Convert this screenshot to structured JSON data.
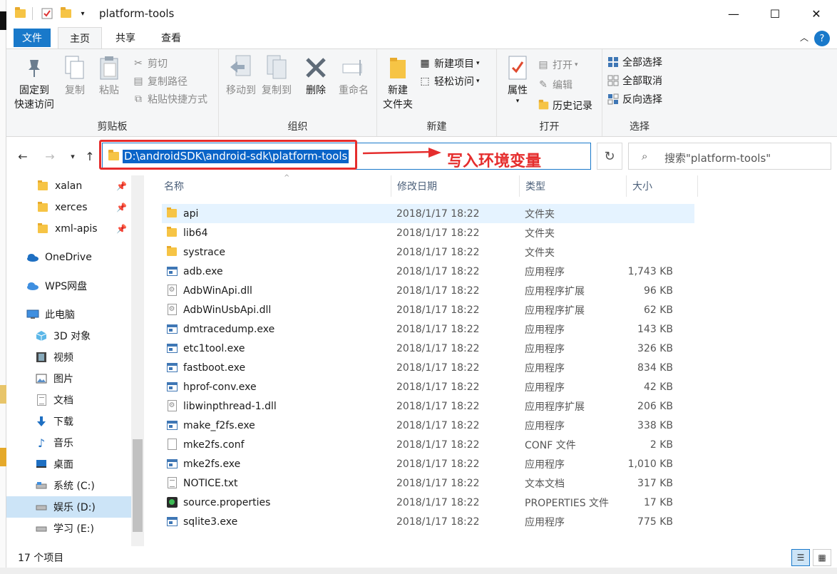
{
  "window": {
    "title": "platform-tools",
    "controls": {
      "minimize": "—",
      "maximize": "☐",
      "close": "✕"
    }
  },
  "tabs": {
    "file": "文件",
    "home": "主页",
    "share": "共享",
    "view": "查看",
    "help": "?"
  },
  "ribbon": {
    "clipboard": {
      "label": "剪贴板",
      "pin": "固定到\n快速访问",
      "pin_l1": "固定到",
      "pin_l2": "快速访问",
      "copy": "复制",
      "paste": "粘贴",
      "cut": "剪切",
      "copy_path": "复制路径",
      "paste_shortcut": "粘贴快捷方式"
    },
    "organize": {
      "label": "组织",
      "move_to": "移动到",
      "copy_to": "复制到",
      "delete": "删除",
      "rename": "重命名"
    },
    "new": {
      "label": "新建",
      "new_folder_l1": "新建",
      "new_folder_l2": "文件夹",
      "new_item": "新建项目",
      "easy_access": "轻松访问"
    },
    "open": {
      "label": "打开",
      "properties": "属性",
      "open": "打开",
      "edit": "编辑",
      "history": "历史记录"
    },
    "select": {
      "label": "选择",
      "select_all": "全部选择",
      "select_none": "全部取消",
      "invert": "反向选择"
    }
  },
  "address": {
    "path": "D:\\androidSDK\\android-sdk\\platform-tools",
    "annotation": "写入环境变量"
  },
  "search": {
    "placeholder": "搜索\"platform-tools\""
  },
  "nav": {
    "items": [
      {
        "label": "xalan",
        "icon": "folder-icon",
        "pinned": true
      },
      {
        "label": "xerces",
        "icon": "folder-icon",
        "pinned": true
      },
      {
        "label": "xml-apis",
        "icon": "folder-icon",
        "pinned": true
      },
      {
        "label": "OneDrive",
        "icon": "cloud-icon"
      },
      {
        "label": "WPS网盘",
        "icon": "cloud-icon"
      },
      {
        "label": "此电脑",
        "icon": "computer-icon"
      },
      {
        "label": "3D 对象",
        "icon": "cube-icon"
      },
      {
        "label": "视频",
        "icon": "video-icon"
      },
      {
        "label": "图片",
        "icon": "picture-icon"
      },
      {
        "label": "文档",
        "icon": "document-icon"
      },
      {
        "label": "下载",
        "icon": "download-icon"
      },
      {
        "label": "音乐",
        "icon": "music-icon"
      },
      {
        "label": "桌面",
        "icon": "desktop-icon"
      },
      {
        "label": "系统 (C:)",
        "icon": "drive-icon"
      },
      {
        "label": "娱乐 (D:)",
        "icon": "drive-icon",
        "selected": true
      },
      {
        "label": "学习 (E:)",
        "icon": "drive-icon"
      }
    ]
  },
  "columns": {
    "name": "名称",
    "date": "修改日期",
    "type": "类型",
    "size": "大小"
  },
  "files": [
    {
      "name": "api",
      "date": "2018/1/17 18:22",
      "type": "文件夹",
      "size": "",
      "icon": "folder"
    },
    {
      "name": "lib64",
      "date": "2018/1/17 18:22",
      "type": "文件夹",
      "size": "",
      "icon": "folder"
    },
    {
      "name": "systrace",
      "date": "2018/1/17 18:22",
      "type": "文件夹",
      "size": "",
      "icon": "folder"
    },
    {
      "name": "adb.exe",
      "date": "2018/1/17 18:22",
      "type": "应用程序",
      "size": "1,743 KB",
      "icon": "exe"
    },
    {
      "name": "AdbWinApi.dll",
      "date": "2018/1/17 18:22",
      "type": "应用程序扩展",
      "size": "96 KB",
      "icon": "dll"
    },
    {
      "name": "AdbWinUsbApi.dll",
      "date": "2018/1/17 18:22",
      "type": "应用程序扩展",
      "size": "62 KB",
      "icon": "dll"
    },
    {
      "name": "dmtracedump.exe",
      "date": "2018/1/17 18:22",
      "type": "应用程序",
      "size": "143 KB",
      "icon": "exe"
    },
    {
      "name": "etc1tool.exe",
      "date": "2018/1/17 18:22",
      "type": "应用程序",
      "size": "326 KB",
      "icon": "exe"
    },
    {
      "name": "fastboot.exe",
      "date": "2018/1/17 18:22",
      "type": "应用程序",
      "size": "834 KB",
      "icon": "exe"
    },
    {
      "name": "hprof-conv.exe",
      "date": "2018/1/17 18:22",
      "type": "应用程序",
      "size": "42 KB",
      "icon": "exe"
    },
    {
      "name": "libwinpthread-1.dll",
      "date": "2018/1/17 18:22",
      "type": "应用程序扩展",
      "size": "206 KB",
      "icon": "dll"
    },
    {
      "name": "make_f2fs.exe",
      "date": "2018/1/17 18:22",
      "type": "应用程序",
      "size": "338 KB",
      "icon": "exe"
    },
    {
      "name": "mke2fs.conf",
      "date": "2018/1/17 18:22",
      "type": "CONF 文件",
      "size": "2 KB",
      "icon": "doc"
    },
    {
      "name": "mke2fs.exe",
      "date": "2018/1/17 18:22",
      "type": "应用程序",
      "size": "1,010 KB",
      "icon": "exe"
    },
    {
      "name": "NOTICE.txt",
      "date": "2018/1/17 18:22",
      "type": "文本文档",
      "size": "317 KB",
      "icon": "txt"
    },
    {
      "name": "source.properties",
      "date": "2018/1/17 18:22",
      "type": "PROPERTIES 文件",
      "size": "17 KB",
      "icon": "prop"
    },
    {
      "name": "sqlite3.exe",
      "date": "2018/1/17 18:22",
      "type": "应用程序",
      "size": "775 KB",
      "icon": "exe"
    }
  ],
  "status": {
    "count": "17 个项目"
  },
  "colors": {
    "accent": "#1979ca",
    "annotation_red": "#e52d2d",
    "selection": "#cce4f7"
  }
}
